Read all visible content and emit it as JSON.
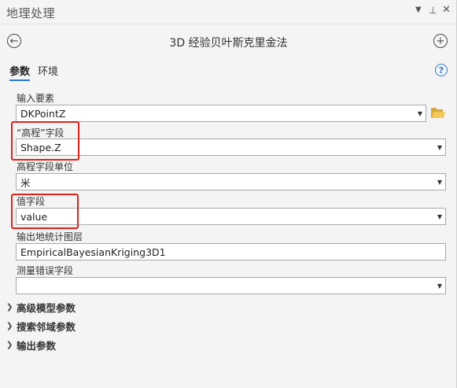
{
  "pane": {
    "title": "地理处理"
  },
  "tool": {
    "title": "3D 经验贝叶斯克里金法"
  },
  "tabs": [
    {
      "label": "参数"
    },
    {
      "label": "环境"
    }
  ],
  "help": {
    "symbol": "?"
  },
  "fields": [
    {
      "label": "输入要素",
      "value": "DKPointZ"
    },
    {
      "label": "“高程”字段",
      "value": "Shape.Z"
    },
    {
      "label": "高程字段单位",
      "value": "米"
    },
    {
      "label": "值字段",
      "value": "value"
    },
    {
      "label": "输出地统计图层",
      "value": "EmpiricalBayesianKriging3D1"
    },
    {
      "label": "测量错误字段",
      "value": ""
    }
  ],
  "sections": [
    {
      "label": "高级模型参数"
    },
    {
      "label": "搜索邻域参数"
    },
    {
      "label": "输出参数"
    }
  ],
  "highlight_color": "#e0211a",
  "accent_color": "#2a7bd4",
  "icons": [
    "back-arrow-icon",
    "add-icon",
    "help-icon",
    "folder-icon",
    "dropdown-caret-icon",
    "expand-chevron-icon",
    "pin-icon",
    "close-icon"
  ]
}
